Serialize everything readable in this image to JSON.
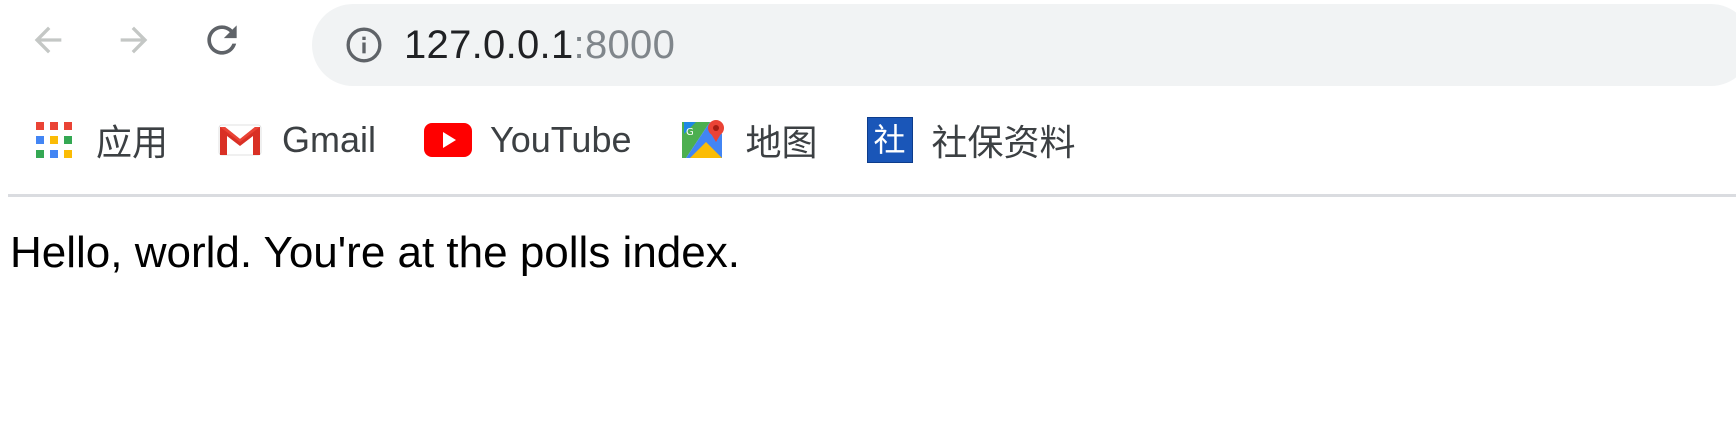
{
  "toolbar": {
    "back_icon": "arrow-left-icon",
    "forward_icon": "arrow-right-icon",
    "reload_icon": "reload-icon",
    "address": {
      "info_icon": "info-icon",
      "host": "127.0.0.1",
      "port": ":8000"
    }
  },
  "bookmarks": [
    {
      "label": "应用",
      "icon": "apps-grid-icon"
    },
    {
      "label": "Gmail",
      "icon": "gmail-icon"
    },
    {
      "label": "YouTube",
      "icon": "youtube-icon"
    },
    {
      "label": "地图",
      "icon": "maps-icon"
    },
    {
      "label": "社保资料",
      "icon": "shebao-icon",
      "icon_text": "社"
    }
  ],
  "page": {
    "text": "Hello, world. You're at the polls index."
  },
  "colors": {
    "omnibox_bg": "#f1f3f4",
    "port_text": "#80868b",
    "divider": "#dadce0",
    "youtube_red": "#ff0000",
    "gmail_red": "#ea4335",
    "shebao_blue": "#1a56b8"
  }
}
